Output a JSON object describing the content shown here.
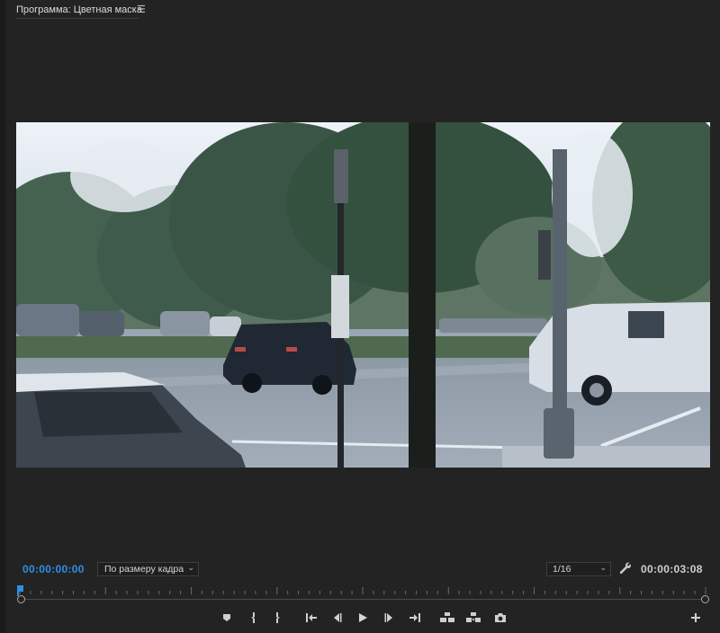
{
  "panel": {
    "title": "Программа: Цветная маска",
    "menu_icon": "hamburger-menu-icon"
  },
  "controls": {
    "current_timecode": "00:00:00:00",
    "fit_option": "По размеру кадра",
    "resolution_option": "1/16",
    "duration_timecode": "00:00:03:08",
    "settings_icon": "wrench-icon"
  },
  "transport_icons": [
    "add-marker-icon",
    "mark-in-icon",
    "mark-out-icon",
    "go-to-in-icon",
    "step-back-icon",
    "play-icon",
    "step-forward-icon",
    "go-to-out-icon",
    "lift-icon",
    "extract-icon",
    "export-frame-icon",
    "button-editor-plus-icon"
  ],
  "colors": {
    "background": "#232323",
    "accent_blue": "#2f8fe6",
    "text": "#cfcfcf"
  }
}
